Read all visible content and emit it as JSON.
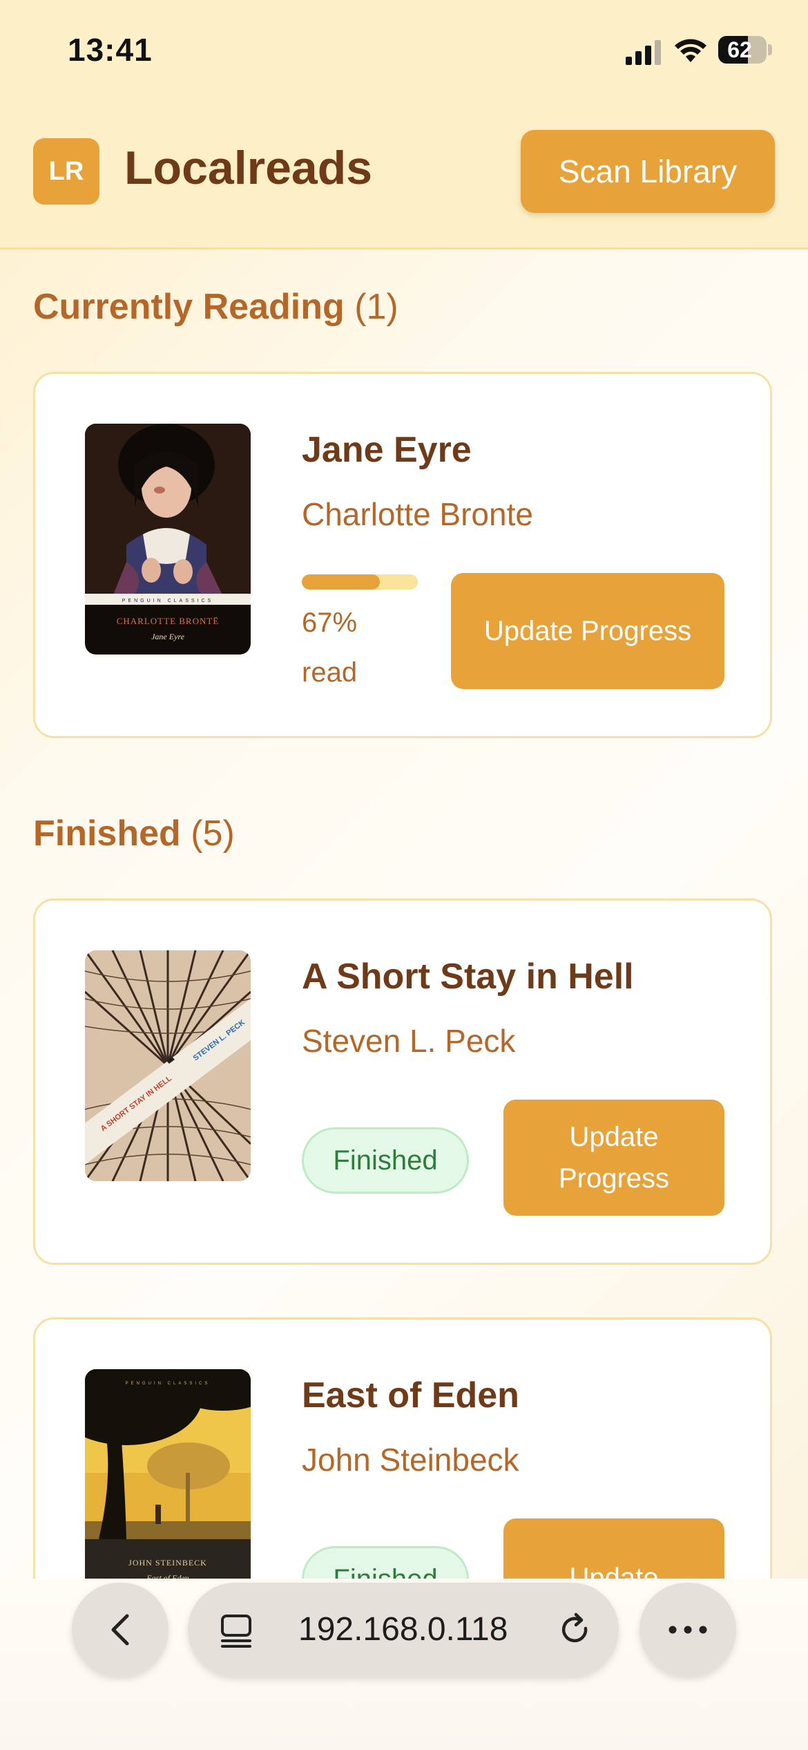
{
  "status_bar": {
    "time": "13:41",
    "battery": "62",
    "battery_level": 0.62
  },
  "header": {
    "logo_text": "LR",
    "title": "Localreads",
    "scan_button": "Scan Library"
  },
  "sections": {
    "reading": {
      "title": "Currently Reading",
      "count": "(1)"
    },
    "finished": {
      "title": "Finished",
      "count": "(5)"
    }
  },
  "books": {
    "jane_eyre": {
      "title": "Jane Eyre",
      "author": "Charlotte Bronte",
      "progress_text": "67% read",
      "progress_value": 0.67,
      "update_button": "Update Progress",
      "cover_author": "CHARLOTTE BRONTË",
      "cover_title": "Jane Eyre",
      "cover_publisher": "PENGUIN CLASSICS"
    },
    "short_stay": {
      "title": "A Short Stay in Hell",
      "author": "Steven L. Peck",
      "status": "Finished",
      "update_button": "Update Progress",
      "cover_title": "A SHORT STAY IN HELL",
      "cover_author": "STEVEN L. PECK"
    },
    "east_of_eden": {
      "title": "East of Eden",
      "author": "John Steinbeck",
      "status": "Finished",
      "update_button": "Update",
      "cover_author": "JOHN STEINBECK",
      "cover_title": "East of Eden",
      "cover_publisher": "PENGUIN CLASSICS"
    }
  },
  "browser": {
    "url": "192.168.0.118"
  },
  "colors": {
    "accent": "#e8a23a",
    "header_bg": "#fdf0c8",
    "text_brown": "#6e3a18",
    "text_rust": "#b5672a",
    "finished_green": "#2f7d3d"
  }
}
